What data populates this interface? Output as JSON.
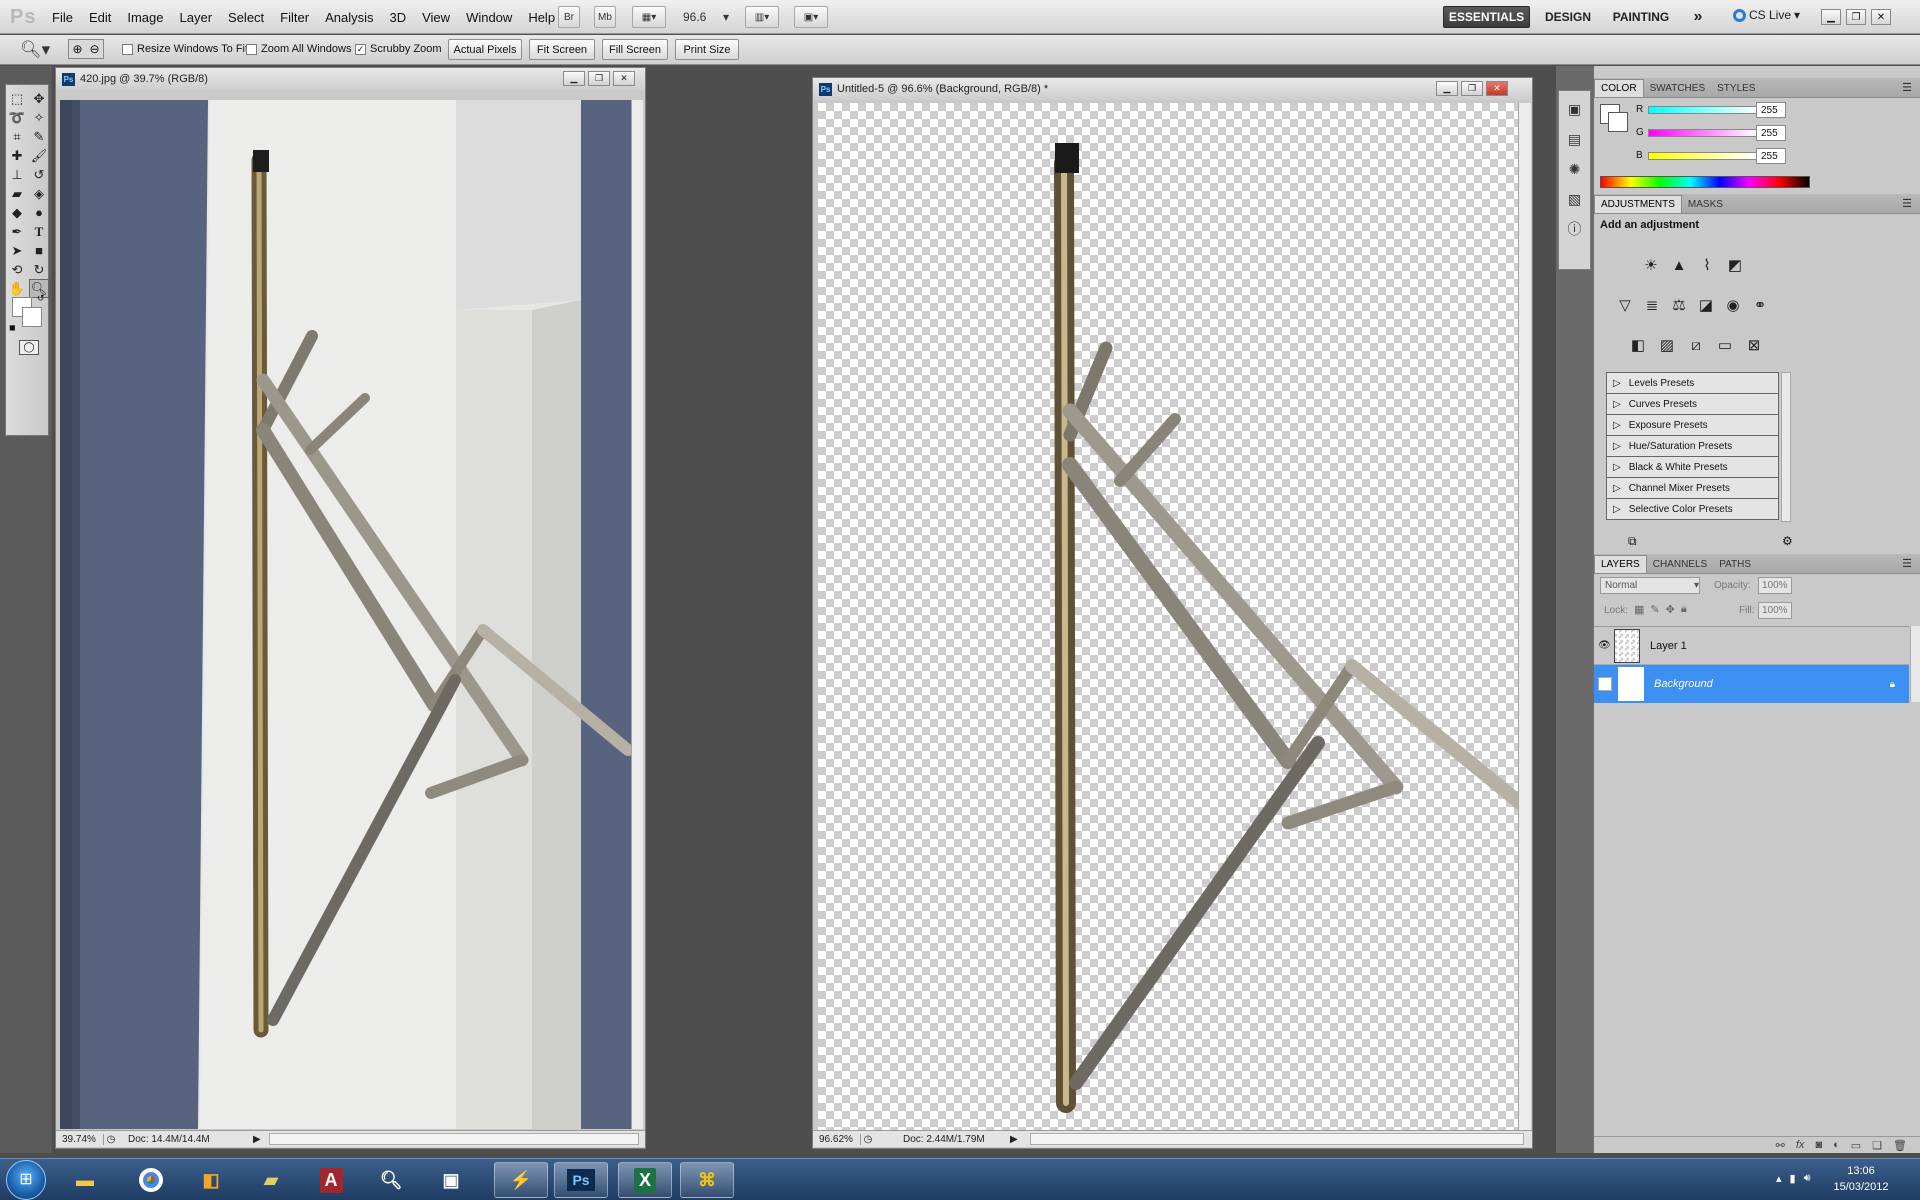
{
  "app": {
    "logo": "Ps"
  },
  "menu": [
    "File",
    "Edit",
    "Image",
    "Layer",
    "Select",
    "Filter",
    "Analysis",
    "3D",
    "View",
    "Window",
    "Help"
  ],
  "menubar_buttons": {
    "bridge": "Br",
    "minibridge": "Mb",
    "zoom": "96.6"
  },
  "workspaces": {
    "essentials": "ESSENTIALS",
    "design": "DESIGN",
    "painting": "PAINTING",
    "more": "»",
    "cslive": "CS Live"
  },
  "options": {
    "resize_windows": "Resize Windows To Fit",
    "zoom_all": "Zoom All Windows",
    "scrubby_zoom": "Scrubby Zoom",
    "actual_pixels": "Actual Pixels",
    "fit_screen": "Fit Screen",
    "fill_screen": "Fill Screen",
    "print_size": "Print Size"
  },
  "doc1": {
    "title": "420.jpg @ 39.7% (RGB/8)",
    "zoom": "39.74%",
    "info": "Doc: 14.4M/14.4M"
  },
  "doc2": {
    "title": "Untitled-5 @ 96.6% (Background, RGB/8) *",
    "zoom": "96.62%",
    "info": "Doc: 2.44M/1.79M"
  },
  "color_panel": {
    "tabs": [
      "COLOR",
      "SWATCHES",
      "STYLES"
    ],
    "r_label": "R",
    "g_label": "G",
    "b_label": "B",
    "r": "255",
    "g": "255",
    "b": "255"
  },
  "adjustments": {
    "tabs": [
      "ADJUSTMENTS",
      "MASKS"
    ],
    "heading": "Add an adjustment",
    "presets": [
      "Levels Presets",
      "Curves Presets",
      "Exposure Presets",
      "Hue/Saturation Presets",
      "Black & White Presets",
      "Channel Mixer Presets",
      "Selective Color Presets"
    ]
  },
  "layers_panel": {
    "tabs": [
      "LAYERS",
      "CHANNELS",
      "PATHS"
    ],
    "blend_mode": "Normal",
    "opacity_label": "Opacity:",
    "opacity": "100%",
    "lock_label": "Lock:",
    "fill_label": "Fill:",
    "fill": "100%",
    "layers": [
      {
        "name": "Layer 1",
        "visible": true
      },
      {
        "name": "Background",
        "selected": true
      }
    ]
  },
  "clock": {
    "time": "13:06",
    "date": "15/03/2012"
  },
  "colors": {
    "selection": "#3e8ff2",
    "app_bg": "#4e4e4e"
  }
}
